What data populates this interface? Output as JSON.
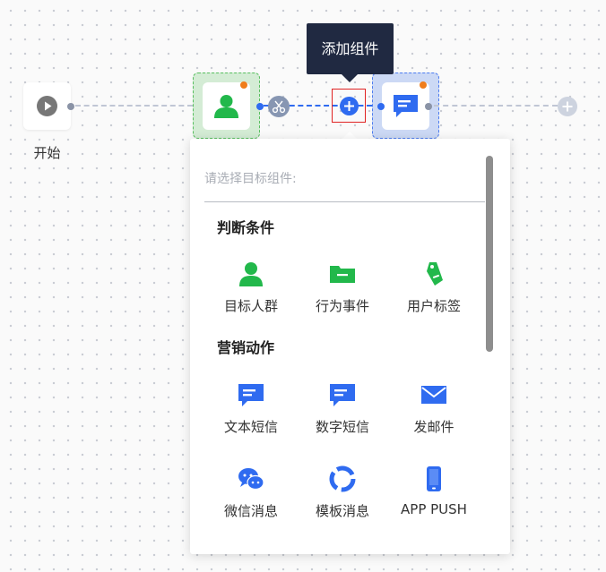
{
  "canvas": {
    "start_label": "开始",
    "tooltip": "添加组件"
  },
  "icons": {
    "start": "play-icon",
    "node1": "user-icon",
    "node2": "message-icon",
    "scissor": "scissors-icon",
    "add": "plus-circle-icon",
    "end_add": "plus-circle-icon"
  },
  "colors": {
    "green": "#22b84b",
    "blue": "#2f6bf0",
    "badge": "#f07d1b"
  },
  "popup": {
    "prompt": "请选择目标组件:",
    "sections": [
      {
        "title": "判断条件",
        "items": [
          {
            "label": "目标人群",
            "icon": "user-icon"
          },
          {
            "label": "行为事件",
            "icon": "folder-icon"
          },
          {
            "label": "用户标签",
            "icon": "tag-icon"
          }
        ]
      },
      {
        "title": "营销动作",
        "items": [
          {
            "label": "文本短信",
            "icon": "sms-icon"
          },
          {
            "label": "数字短信",
            "icon": "sms-icon"
          },
          {
            "label": "发邮件",
            "icon": "mail-icon"
          },
          {
            "label": "微信消息",
            "icon": "wechat-icon"
          },
          {
            "label": "模板消息",
            "icon": "template-icon"
          },
          {
            "label": "APP PUSH",
            "icon": "phone-icon"
          }
        ]
      }
    ]
  }
}
